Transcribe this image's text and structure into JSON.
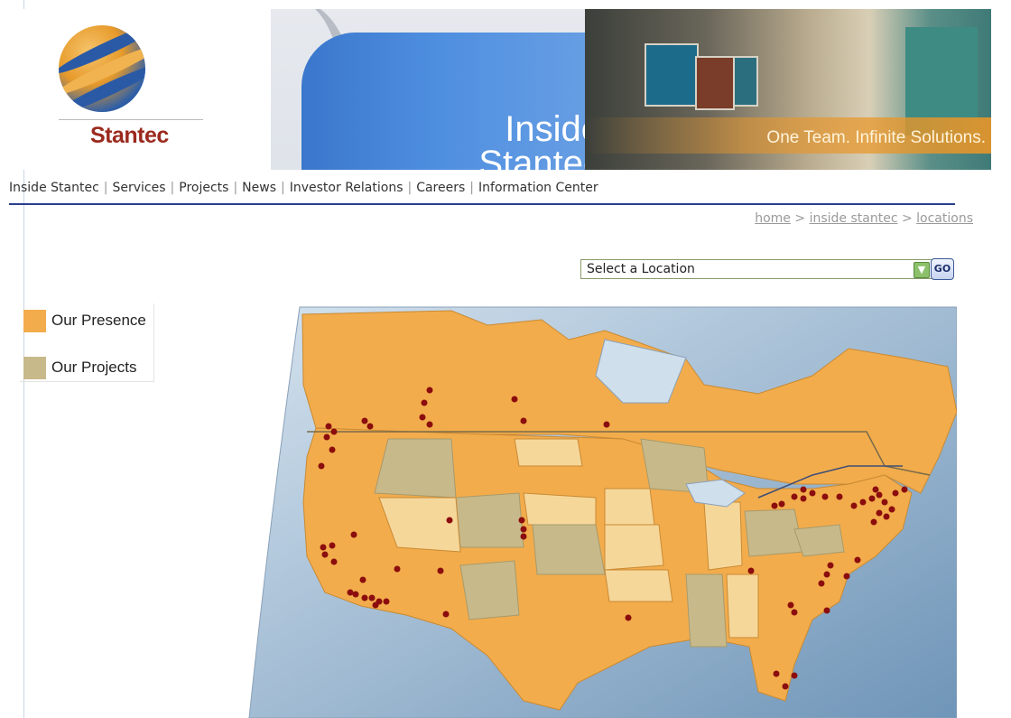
{
  "header": {
    "logo_text": "Stantec",
    "banner_title_line1": "Inside",
    "banner_title_line2": "Stantec",
    "tagline": "One Team. Infinite Solutions."
  },
  "nav": {
    "items": [
      "Inside Stantec",
      "Services",
      "Projects",
      "News",
      "Investor Relations",
      "Careers",
      "Information Center"
    ]
  },
  "breadcrumb": {
    "home": "home",
    "separator": ">",
    "section": "inside stantec",
    "current": "locations"
  },
  "location_select": {
    "selected": "Select a Location",
    "go_label": "GO"
  },
  "legend": {
    "presence_label": "Our Presence",
    "projects_label": "Our Projects"
  },
  "colors": {
    "presence": "#f2ac4c",
    "projects": "#c8b98a",
    "brand_red": "#9b2a1e",
    "nav_rule": "#2a3e8c",
    "location_dot": "#8b0d0d"
  }
}
